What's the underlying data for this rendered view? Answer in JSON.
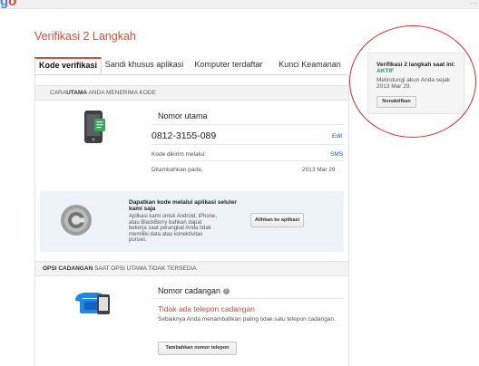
{
  "header": {
    "logo_fragment_g": "g",
    "logo_fragment_o": "o",
    "account_fragment": "…"
  },
  "page": {
    "title": "Verifikasi 2 Langkah"
  },
  "tabs": [
    {
      "label": "Kode verifikasi",
      "active": true
    },
    {
      "label": "Sandi khusus aplikasi",
      "active": false
    },
    {
      "label": "Komputer terdaftar",
      "active": false
    },
    {
      "label": "Kunci Keamanan",
      "active": false
    }
  ],
  "receive_section": {
    "heading_bold": "CARA",
    "heading_bold2": "UTAMA",
    "heading_rest": " ANDA MENERIMA KODE",
    "phone_icon": "smartphone-icon",
    "label": "Nomor utama",
    "number": "0812-3155-089",
    "edit": "Edit",
    "sent_via_label": "Kode dikirim melalui:",
    "sent_via_value": "SMS",
    "added_label": "Ditambahkan pada:",
    "added_value": "2013 Mar 29"
  },
  "app_promo": {
    "icon": "authenticator-icon",
    "title": "Dapatkan kode melalui aplikasi seluler kami saja",
    "text": "Aplikasi kami untuk Android, iPhone, atau BlackBerry bahkan dapat bekerja saat perangkat Anda tidak memiliki data atau konektivitas ponsel.",
    "button": "Alihkan ke aplikasi"
  },
  "backup_section": {
    "heading_bold": "OPSI CADANGAN",
    "heading_rest": " SAAT OPSI UTAMA TIDAK TERSEDIA",
    "icon": "phone-tablet-icon",
    "label": "Nomor cadangan",
    "help_icon": "help-icon",
    "none_text": "Tidak ada telepon cadangan",
    "hint": "Sebaiknya Anda menambahkan paling tidak satu telepon cadangan.",
    "button": "Tambahkan nomor telepon"
  },
  "status_box": {
    "title": "Verifikasi 2 langkah saat ini:",
    "state": "AKTIF",
    "since": "Melindungi akun Anda sejak 2013 Mar 29.",
    "button": "Nonaktifkan"
  },
  "colors": {
    "accent_red": "#dd4b39",
    "link_blue": "#1155cc",
    "active_green": "#0e9d58",
    "annotation_red": "#e0272b"
  }
}
